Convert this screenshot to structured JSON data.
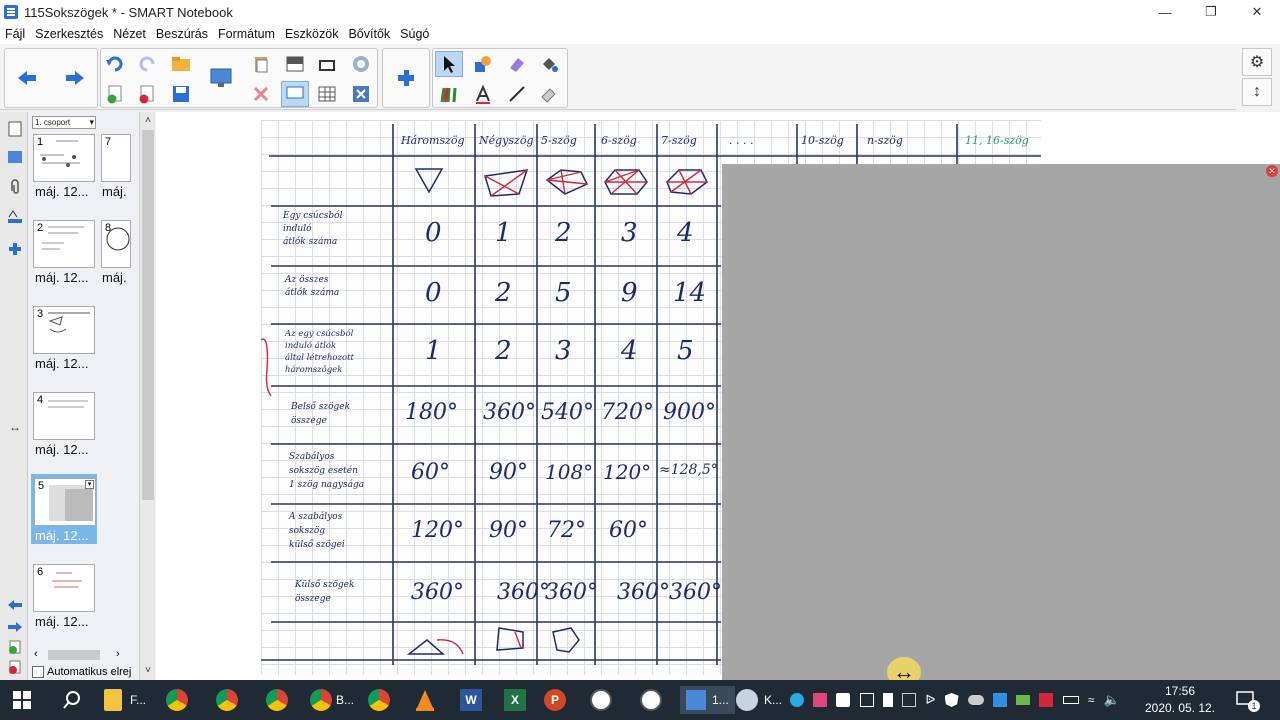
{
  "window": {
    "title": "115Sokszögek * - SMART Notebook"
  },
  "menu": [
    "Fájl",
    "Szerkesztés",
    "Nézet",
    "Beszúrás",
    "Formátum",
    "Eszközök",
    "Bővítők",
    "Súgó"
  ],
  "toolbar": {
    "icons": [
      "back-icon",
      "forward-icon",
      "undo-icon",
      "redo-icon",
      "open-icon",
      "add-page-icon",
      "delete-page-icon",
      "save-icon",
      "display-icon",
      "paste-icon",
      "screenshade-icon",
      "fullscreen-icon",
      "capture-icon",
      "table-icon",
      "delete-icon",
      "addons-icon",
      "select-icon",
      "shapes-icon",
      "eraser-icon",
      "fill-icon",
      "pens-icon",
      "text-icon",
      "line-icon",
      "magic-pen-icon"
    ]
  },
  "sorter": {
    "group": "1. csoport",
    "auto_hide_label": "Automatikus elrej",
    "pages": [
      {
        "num": "1",
        "caption": "máj. 12..."
      },
      {
        "num": "7",
        "caption": "máj."
      },
      {
        "num": "2",
        "caption": "máj. 12..."
      },
      {
        "num": "8",
        "caption": "máj."
      },
      {
        "num": "3",
        "caption": "máj. 12..."
      },
      {
        "num": "4",
        "caption": "máj. 12..."
      },
      {
        "num": "5",
        "caption": "máj. 12..."
      },
      {
        "num": "6",
        "caption": "máj. 12..."
      }
    ]
  },
  "sheet": {
    "headers": [
      "Háromszög",
      "Négyszög",
      "5-szög",
      "6-szög",
      "7-szög",
      ". . . .",
      "10-szög",
      "n-szög",
      "11, 16-szög"
    ],
    "rows": [
      {
        "label": [
          "Egy csúcsból",
          "induló",
          "átlók száma"
        ],
        "values": [
          "0",
          "1",
          "2",
          "3",
          "4"
        ]
      },
      {
        "label": [
          "Az összes",
          "átlók száma"
        ],
        "values": [
          "0",
          "2",
          "5",
          "9",
          "14"
        ]
      },
      {
        "label": [
          "Az egy csúcsból",
          "induló átlók",
          "által létrehozott",
          "háromszögek"
        ],
        "values": [
          "1",
          "2",
          "3",
          "4",
          "5"
        ]
      },
      {
        "label": [
          "Belső szögek",
          "összege"
        ],
        "values": [
          "180°",
          "360°",
          "540°",
          "720°",
          "900°"
        ]
      },
      {
        "label": [
          "Szabályos",
          "sokszög esetén",
          "1 szög nagysága"
        ],
        "values": [
          "60°",
          "90°",
          "108°",
          "120°",
          "≈128,5°"
        ]
      },
      {
        "label": [
          "A szabályos",
          "sokszög",
          "külső szögei"
        ],
        "values": [
          "120°",
          "90°",
          "72°",
          "60°",
          ""
        ]
      },
      {
        "label": [
          "Külső szögek",
          "összege"
        ],
        "values": [
          "360°",
          "360°",
          "360°",
          "360°",
          "360°"
        ]
      }
    ]
  },
  "taskbar": {
    "items": [
      "F...",
      "",
      "",
      "B...",
      "",
      "",
      "",
      "",
      "",
      "",
      "",
      "1...",
      "K..."
    ],
    "time": "17:56",
    "date": "2020. 05. 12.",
    "notifications": "1"
  },
  "colors": {
    "accent": "#2a6fd6",
    "ink": "#1e2a6e",
    "red": "#d4283a",
    "selection": "#79b7ea",
    "panel": "#a6a6a6"
  }
}
